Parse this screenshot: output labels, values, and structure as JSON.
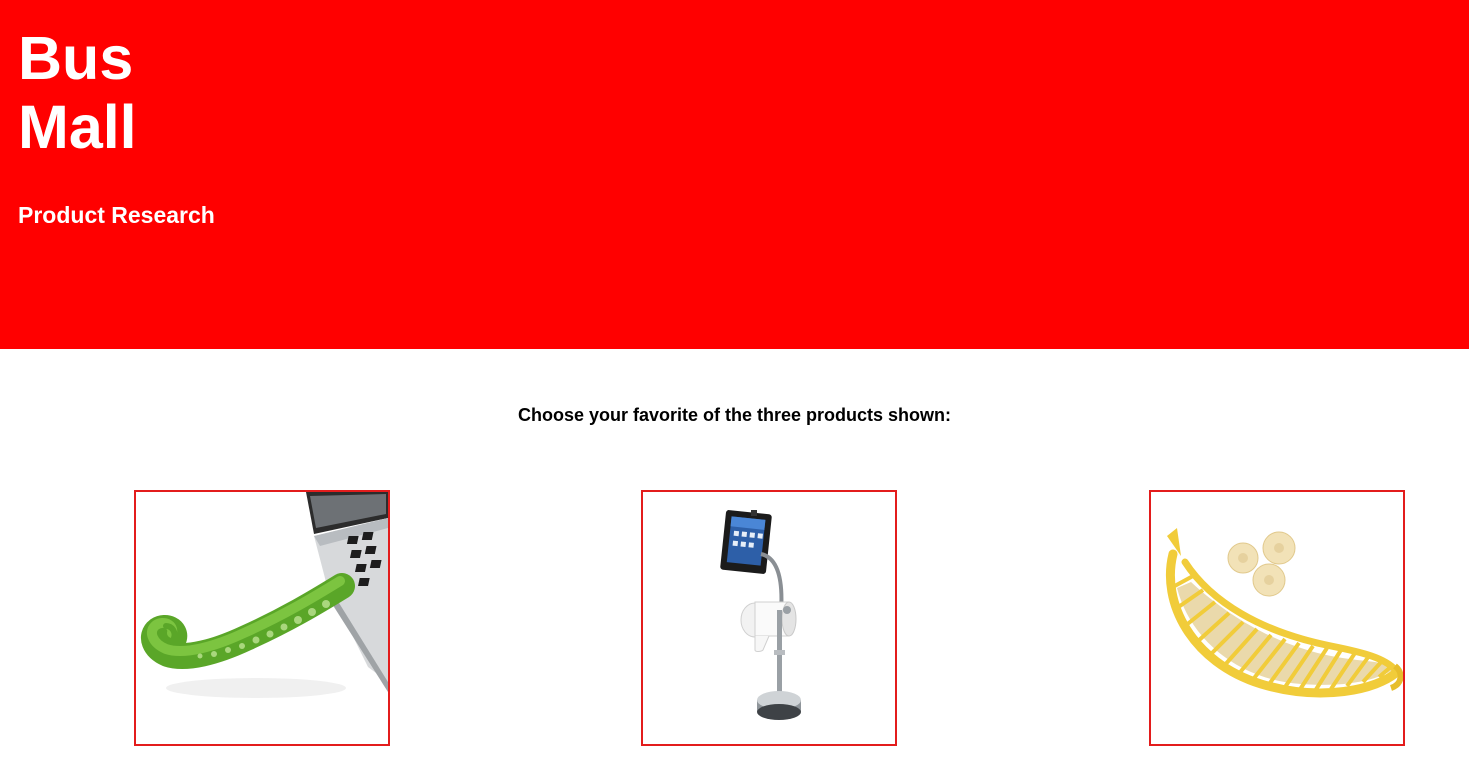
{
  "header": {
    "title_line1": "Bus",
    "title_line2": "Mall",
    "subtitle": "Product Research",
    "background_color": "#ff0000"
  },
  "main": {
    "prompt": "Choose your favorite of the three products shown:",
    "products": [
      {
        "icon": "tentacle-usb-icon"
      },
      {
        "icon": "ipad-toilet-paper-stand-icon"
      },
      {
        "icon": "banana-slicer-icon"
      }
    ],
    "border_color": "#e31c1c"
  }
}
